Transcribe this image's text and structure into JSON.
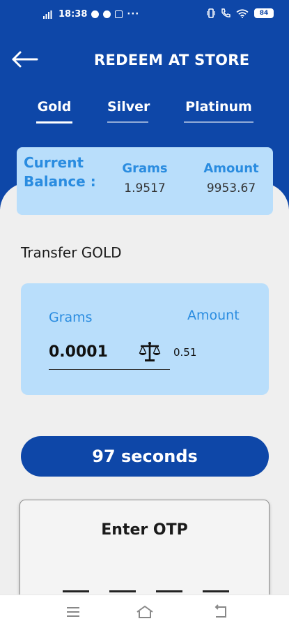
{
  "status_bar": {
    "time": "18:38",
    "more": "···",
    "battery": "84"
  },
  "header": {
    "title": "REDEEM AT STORE"
  },
  "tabs": [
    {
      "label": "Gold",
      "active": true
    },
    {
      "label": "Silver",
      "active": false
    },
    {
      "label": "Platinum",
      "active": false
    }
  ],
  "balance": {
    "label": "Current Balance :",
    "grams_header": "Grams",
    "grams_value": "1.9517",
    "amount_header": "Amount",
    "amount_value": "9953.67"
  },
  "transfer": {
    "title": "Transfer GOLD",
    "grams_label": "Grams",
    "amount_label": "Amount",
    "grams_value": "0.0001",
    "amount_value": "0.51"
  },
  "timer": {
    "label": "97 seconds"
  },
  "otp": {
    "title": "Enter OTP"
  },
  "colors": {
    "brand_blue": "#0e47a8",
    "light_blue_card": "#b9defb",
    "label_blue": "#2a8ce0"
  },
  "icons": [
    "back-arrow-icon",
    "scale-icon",
    "menu-icon",
    "home-icon",
    "back-icon"
  ]
}
